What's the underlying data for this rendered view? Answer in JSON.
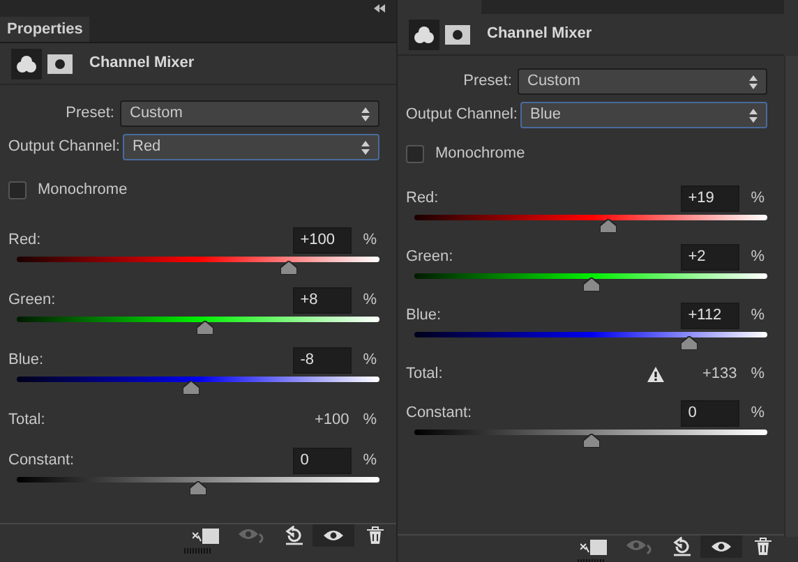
{
  "panels": [
    {
      "tab": {
        "label": "Properties"
      },
      "title": "Channel Mixer",
      "preset": {
        "label": "Preset:",
        "value": "Custom"
      },
      "output_channel": {
        "label": "Output Channel:",
        "value": "Red"
      },
      "monochrome": {
        "label": "Monochrome",
        "checked": false
      },
      "channels": [
        {
          "kind": "red",
          "name": "Red:",
          "value": "+100",
          "unit": "%",
          "level": 0.75
        },
        {
          "kind": "green",
          "name": "Green:",
          "value": "+8",
          "unit": "%",
          "level": 0.52
        },
        {
          "kind": "blue",
          "name": "Blue:",
          "value": "-8",
          "unit": "%",
          "level": 0.48
        }
      ],
      "total": {
        "label": "Total:",
        "value": "+100",
        "unit": "%",
        "warning": false
      },
      "constant": {
        "label": "Constant:",
        "value": "0",
        "unit": "%",
        "level": 0.5
      }
    },
    {
      "title": "Channel Mixer",
      "preset": {
        "label": "Preset:",
        "value": "Custom"
      },
      "output_channel": {
        "label": "Output Channel:",
        "value": "Blue"
      },
      "monochrome": {
        "label": "Monochrome",
        "checked": false
      },
      "channels": [
        {
          "kind": "red",
          "name": "Red:",
          "value": "+19",
          "unit": "%",
          "level": 0.55
        },
        {
          "kind": "green",
          "name": "Green:",
          "value": "+2",
          "unit": "%",
          "level": 0.5
        },
        {
          "kind": "blue",
          "name": "Blue:",
          "value": "+112",
          "unit": "%",
          "level": 0.78
        }
      ],
      "total": {
        "label": "Total:",
        "value": "+133",
        "unit": "%",
        "warning": true
      },
      "constant": {
        "label": "Constant:",
        "value": "0",
        "unit": "%",
        "level": 0.5
      }
    }
  ]
}
